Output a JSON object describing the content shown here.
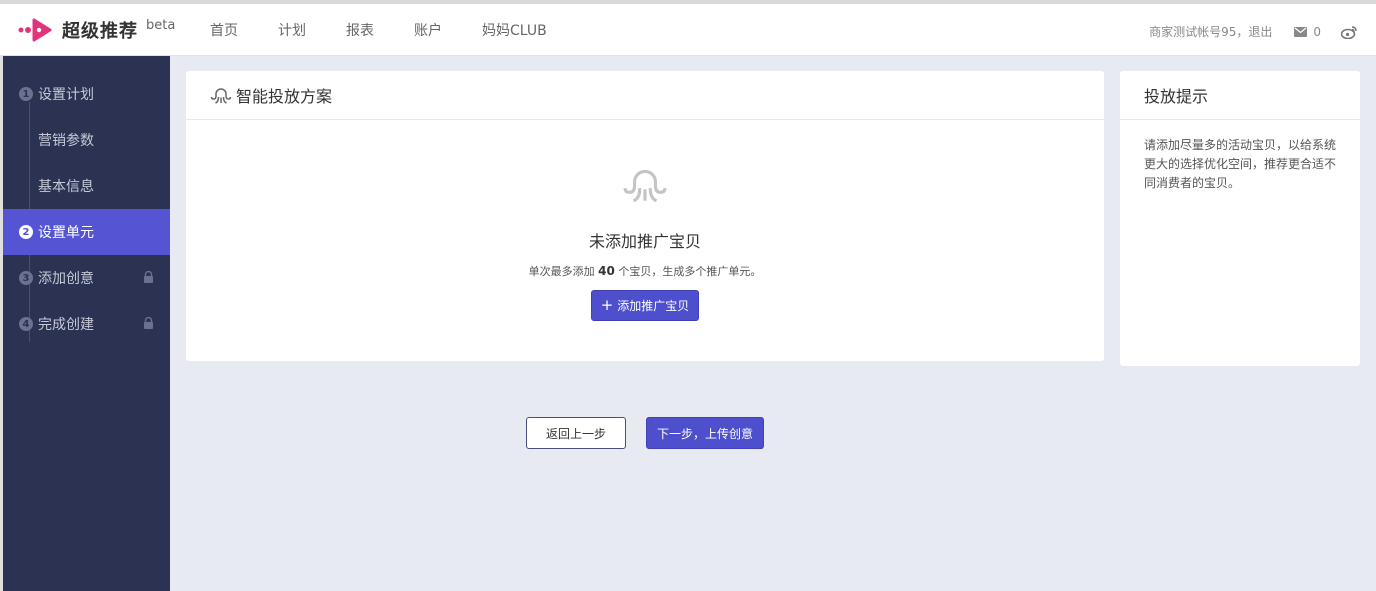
{
  "app": {
    "logo_text": "超级推荐",
    "logo_badge": "beta",
    "brand_colors": {
      "primary": "#4d4fcd",
      "sidebar_bg": "#2c3352",
      "logo_pink": "#e0357e"
    }
  },
  "nav": {
    "items": [
      "首页",
      "计划",
      "报表",
      "账户",
      "妈妈CLUB"
    ]
  },
  "header": {
    "user_text": "商家测试帐号95，退出",
    "message_count": "0",
    "icons": [
      "mail-icon",
      "weibo-icon"
    ]
  },
  "sidebar": {
    "items": [
      {
        "num": "1",
        "label": "设置计划",
        "active": false,
        "sub": false
      },
      {
        "num": "",
        "label": "营销参数",
        "active": false,
        "sub": true
      },
      {
        "num": "",
        "label": "基本信息",
        "active": false,
        "sub": true
      },
      {
        "num": "2",
        "label": "设置单元",
        "active": true,
        "sub": false
      },
      {
        "num": "3",
        "label": "添加创意",
        "active": false,
        "sub": false,
        "locked": true
      },
      {
        "num": "4",
        "label": "完成创建",
        "active": false,
        "sub": false,
        "locked": true
      }
    ]
  },
  "main_card": {
    "title": "智能投放方案",
    "empty_title": "未添加推广宝贝",
    "empty_desc_prefix": "单次最多添加 ",
    "empty_desc_count": "40",
    "empty_desc_suffix": " 个宝贝，生成多个推广单元。",
    "add_button": "添加推广宝贝"
  },
  "tip_card": {
    "title": "投放提示",
    "body": "请添加尽量多的活动宝贝，以给系统更大的选择优化空间，推荐更合适不同消费者的宝贝。"
  },
  "footer_buttons": {
    "back": "返回上一步",
    "next": "下一步，上传创意"
  }
}
